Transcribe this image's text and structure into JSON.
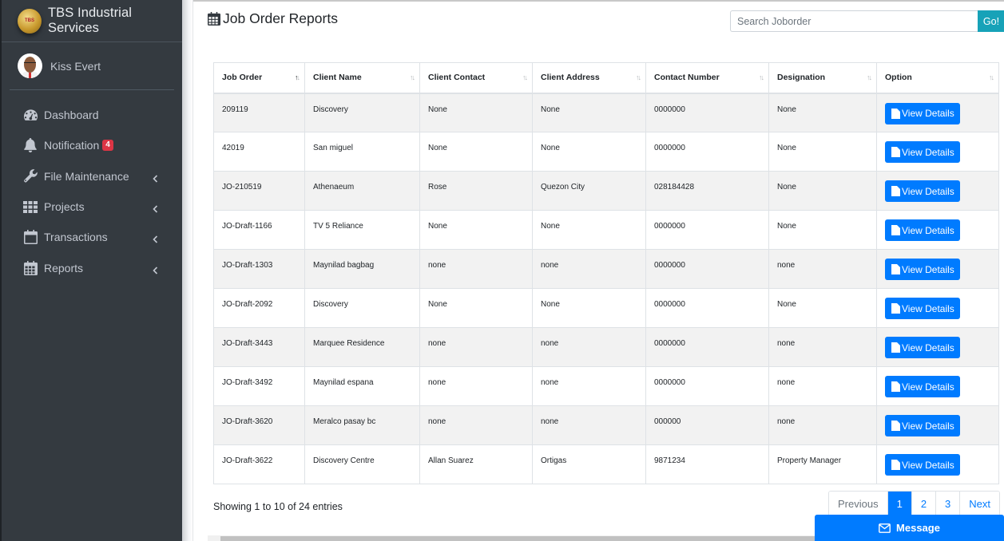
{
  "sidebar": {
    "brand_text": "TBS Industrial Services",
    "brand_logo_text": "TBS",
    "user_name": "Kiss Evert",
    "items": [
      {
        "label": "Dashboard",
        "icon": "dashboard-icon"
      },
      {
        "label": "Notification",
        "icon": "bell-icon",
        "badge": "4"
      },
      {
        "label": "File Maintenance",
        "icon": "wrench-icon",
        "has_submenu": true
      },
      {
        "label": "Projects",
        "icon": "grid-icon",
        "has_submenu": true
      },
      {
        "label": "Transactions",
        "icon": "calendar-icon",
        "has_submenu": true
      },
      {
        "label": "Reports",
        "icon": "calendar-grid-icon",
        "has_submenu": true
      }
    ]
  },
  "header": {
    "title": "Job Order Reports",
    "title_icon": "calendar-icon"
  },
  "search": {
    "placeholder": "Search Joborder",
    "value": "",
    "button_label": "Go!"
  },
  "table": {
    "columns": [
      "Job Order",
      "Client Name",
      "Client Contact",
      "Client Address",
      "Contact Number",
      "Designation",
      "Option"
    ],
    "sorted_column": "Job Order",
    "sort_direction": "ascending",
    "rows": [
      {
        "job_order": "209119",
        "client_name": "Discovery",
        "client_contact": "None",
        "client_address": "None",
        "contact_number": "0000000",
        "designation": "None"
      },
      {
        "job_order": "42019",
        "client_name": "San miguel",
        "client_contact": "None",
        "client_address": "None",
        "contact_number": "0000000",
        "designation": "None"
      },
      {
        "job_order": "JO-210519",
        "client_name": "Athenaeum",
        "client_contact": "Rose",
        "client_address": "Quezon City",
        "contact_number": "028184428",
        "designation": "None"
      },
      {
        "job_order": "JO-Draft-1166",
        "client_name": "TV 5 Reliance",
        "client_contact": "None",
        "client_address": "None",
        "contact_number": "0000000",
        "designation": "None"
      },
      {
        "job_order": "JO-Draft-1303",
        "client_name": "Maynilad bagbag",
        "client_contact": "none",
        "client_address": "none",
        "contact_number": "0000000",
        "designation": "none"
      },
      {
        "job_order": "JO-Draft-2092",
        "client_name": "Discovery",
        "client_contact": "None",
        "client_address": "None",
        "contact_number": "0000000",
        "designation": "None"
      },
      {
        "job_order": "JO-Draft-3443",
        "client_name": "Marquee Residence",
        "client_contact": "none",
        "client_address": "none",
        "contact_number": "0000000",
        "designation": "none"
      },
      {
        "job_order": "JO-Draft-3492",
        "client_name": "Maynilad espana",
        "client_contact": "none",
        "client_address": "none",
        "contact_number": "0000000",
        "designation": "none"
      },
      {
        "job_order": "JO-Draft-3620",
        "client_name": "Meralco pasay bc",
        "client_contact": "none",
        "client_address": "none",
        "contact_number": "000000",
        "designation": "none"
      },
      {
        "job_order": "JO-Draft-3622",
        "client_name": "Discovery Centre",
        "client_contact": "Allan Suarez",
        "client_address": "Ortigas",
        "contact_number": "9871234",
        "designation": "Property Manager"
      }
    ],
    "row_button_label": "View Details"
  },
  "footer": {
    "info": "Showing 1 to 10 of 24 entries",
    "pagination": {
      "previous": "Previous",
      "pages": [
        "1",
        "2",
        "3"
      ],
      "current": "1",
      "next": "Next"
    }
  },
  "message_bar": {
    "label": "Message",
    "icon": "envelope-icon"
  },
  "colors": {
    "sidebar_bg": "#343a40",
    "primary": "#007bff",
    "info": "#17a2b8",
    "danger": "#dc3545",
    "row_stripe": "#f2f2f2"
  }
}
